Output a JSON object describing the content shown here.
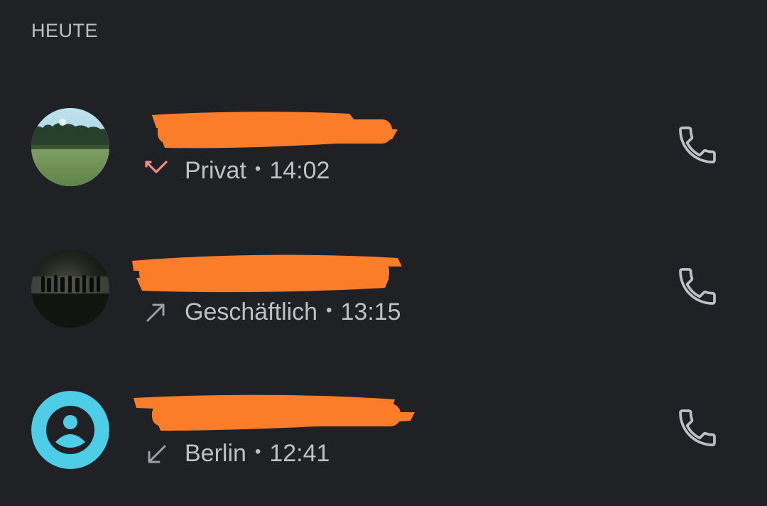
{
  "section": {
    "title": "HEUTE"
  },
  "calls": [
    {
      "name": "",
      "call_type": "missed",
      "call_type_icon": "missed-call-icon",
      "call_type_color": "#f28b82",
      "label": "Privat",
      "separator": "•",
      "time": "14:02",
      "avatar": "photo-landscape"
    },
    {
      "name": "",
      "call_type": "outgoing",
      "call_type_icon": "outgoing-call-icon",
      "call_type_color": "#9aa0a6",
      "label": "Geschäftlich",
      "separator": "•",
      "time": "13:15",
      "avatar": "photo-night-group"
    },
    {
      "name": "",
      "call_type": "incoming",
      "call_type_icon": "incoming-call-icon",
      "call_type_color": "#9aa0a6",
      "label": "Berlin",
      "separator": "•",
      "time": "12:41",
      "avatar": "default-person"
    }
  ],
  "colors": {
    "background": "#202124",
    "primary_text": "#e8eaed",
    "secondary_text": "#bdc1c6",
    "redaction": "#fb7d2a",
    "default_avatar": "#4ecde6"
  }
}
